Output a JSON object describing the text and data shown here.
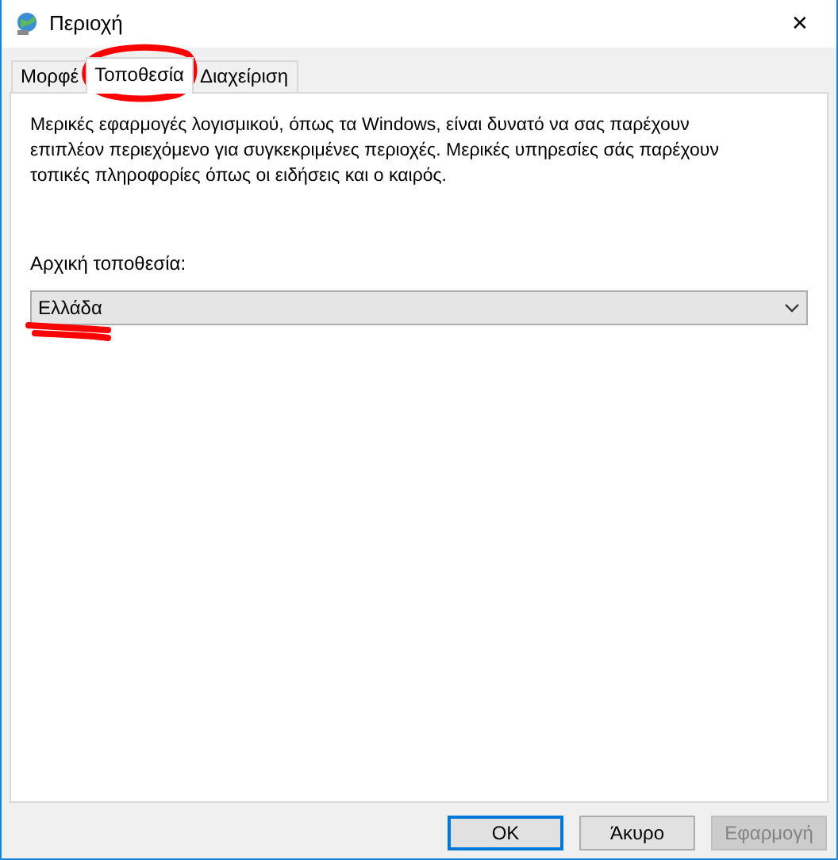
{
  "window": {
    "title": "Περιοχή",
    "close": "✕"
  },
  "tabs": [
    {
      "label": "Μορφέ",
      "selected": false,
      "circled": false
    },
    {
      "label": "Τοποθεσία",
      "selected": true,
      "circled": true
    },
    {
      "label": "Διαχείριση",
      "selected": false,
      "circled": false
    }
  ],
  "description": "Μερικές εφαρμογές λογισμικού, όπως τα Windows, είναι δυνατό να σας παρέχουν επιπλέον περιεχόμενο για συγκεκριμένες περιοχές. Μερικές υπηρεσίες σάς παρέχουν τοπικές πληροφορίες όπως οι ειδήσεις και ο καιρός.",
  "location": {
    "label": "Αρχική τοποθεσία:",
    "value": "Ελλάδα",
    "underlined": true
  },
  "buttons": [
    {
      "label": "OK",
      "default": true,
      "disabled": false
    },
    {
      "label": "Άκυρο",
      "default": false,
      "disabled": false
    },
    {
      "label": "Εφαρμογή",
      "default": false,
      "disabled": true
    }
  ]
}
